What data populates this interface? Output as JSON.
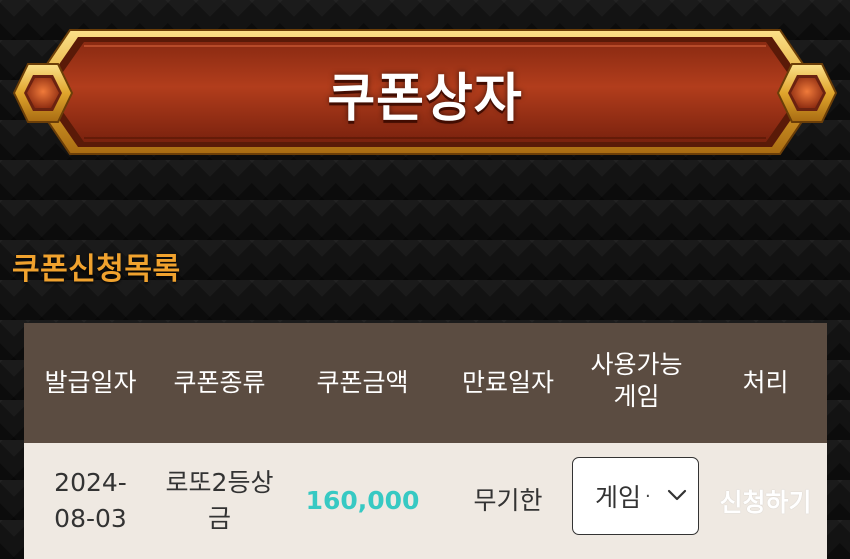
{
  "header": {
    "title": "쿠폰상자"
  },
  "section": {
    "title": "쿠폰신청목록"
  },
  "table": {
    "columns": {
      "issue_date": "발급일자",
      "coupon_type": "쿠폰종류",
      "coupon_amount": "쿠폰금액",
      "expiry": "만료일자",
      "usable_game_line1": "사용가능",
      "usable_game_line2": "게임",
      "action": "처리"
    },
    "row": {
      "issue_date_line1": "2024-",
      "issue_date_line2": "08-03",
      "coupon_type_line1": "로또2등상",
      "coupon_type_line2": "금",
      "coupon_amount": "160,000",
      "expiry": "무기한",
      "game_select_value": "게임",
      "game_select_dot": "·",
      "action_label": "신청하기"
    }
  },
  "colors": {
    "banner_red": "#a8361a",
    "banner_gold": "#e8b23a",
    "section_title": "#f0a22e",
    "header_bg": "#5b4c41",
    "row_bg": "#efe9e2",
    "amount": "#37c9c3"
  },
  "icons": {
    "banner_left": "hex-gem-icon",
    "banner_right": "hex-gem-icon",
    "select_arrow": "chevron-down-icon"
  }
}
